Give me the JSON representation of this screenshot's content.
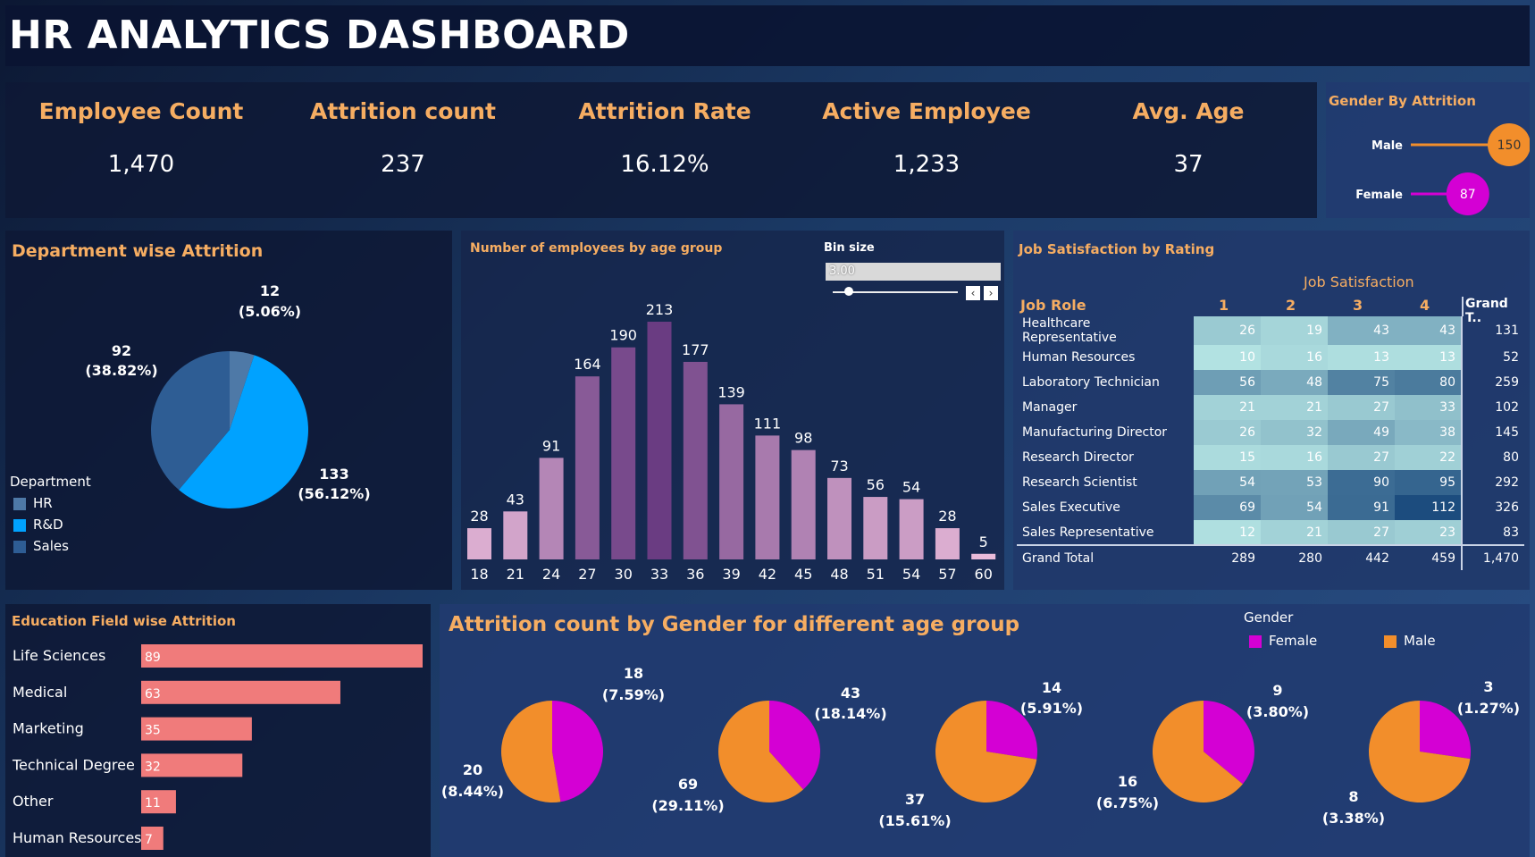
{
  "header": {
    "title": "HR ANALYTICS DASHBOARD"
  },
  "kpis": [
    {
      "label": "Employee Count",
      "value": "1,470"
    },
    {
      "label": "Attrition count",
      "value": "237"
    },
    {
      "label": "Attrition Rate",
      "value": "16.12%"
    },
    {
      "label": "Active Employee",
      "value": "1,233"
    },
    {
      "label": "Avg. Age",
      "value": "37"
    }
  ],
  "colors": {
    "accent": "#f6ad62",
    "hr": "#4e79a7",
    "rnd": "#00a2ff",
    "sales": "#2e5d94",
    "female": "#d400d4",
    "male": "#f28e2b",
    "edu_bar": "#f07b7b"
  },
  "gender_attrition": {
    "title": "Gender By Attrition",
    "rows": [
      {
        "label": "Male",
        "value": 150
      },
      {
        "label": "Female",
        "value": 87
      }
    ]
  },
  "department": {
    "title": "Department wise Attrition",
    "legend_title": "Department",
    "legend": [
      "HR",
      "R&D",
      "Sales"
    ],
    "slices": [
      {
        "name": "HR",
        "value": 12,
        "label": "12",
        "pct": "(5.06%)"
      },
      {
        "name": "R&D",
        "value": 133,
        "label": "133",
        "pct": "(56.12%)"
      },
      {
        "name": "Sales",
        "value": 92,
        "label": "92",
        "pct": "(38.82%)"
      }
    ]
  },
  "age_hist": {
    "title": "Number of employees by age group",
    "bin_label": "Bin size",
    "bin_value": "3.00"
  },
  "job_satisfaction": {
    "title": "Job Satisfaction by Rating",
    "group_header": "Job Satisfaction",
    "col_role": "Job Role",
    "cols": [
      "1",
      "2",
      "3",
      "4"
    ],
    "col_total": "Grand T..",
    "rows": [
      {
        "role": "Healthcare Representative",
        "v": [
          26,
          19,
          43,
          43
        ],
        "total": "131"
      },
      {
        "role": "Human Resources",
        "v": [
          10,
          16,
          13,
          13
        ],
        "total": "52"
      },
      {
        "role": "Laboratory Technician",
        "v": [
          56,
          48,
          75,
          80
        ],
        "total": "259"
      },
      {
        "role": "Manager",
        "v": [
          21,
          21,
          27,
          33
        ],
        "total": "102"
      },
      {
        "role": "Manufacturing Director",
        "v": [
          26,
          32,
          49,
          38
        ],
        "total": "145"
      },
      {
        "role": "Research Director",
        "v": [
          15,
          16,
          27,
          22
        ],
        "total": "80"
      },
      {
        "role": "Research Scientist",
        "v": [
          54,
          53,
          90,
          95
        ],
        "total": "292"
      },
      {
        "role": "Sales Executive",
        "v": [
          69,
          54,
          91,
          112
        ],
        "total": "326"
      },
      {
        "role": "Sales Representative",
        "v": [
          12,
          21,
          27,
          23
        ],
        "total": "83"
      }
    ],
    "grand_total": {
      "role": "Grand Total",
      "v": [
        "289",
        "280",
        "442",
        "459"
      ],
      "total": "1,470"
    }
  },
  "education": {
    "title": "Education Field wise Attrition",
    "items": [
      {
        "label": "Life Sciences",
        "value": 89
      },
      {
        "label": "Medical",
        "value": 63
      },
      {
        "label": "Marketing",
        "value": 35
      },
      {
        "label": "Technical Degree",
        "value": 32
      },
      {
        "label": "Other",
        "value": 11
      },
      {
        "label": "Human Resources",
        "value": 7
      }
    ]
  },
  "gender_age": {
    "title": "Attrition count by Gender for different age group",
    "legend_title": "Gender",
    "legend": [
      "Female",
      "Male"
    ]
  },
  "chart_data": [
    {
      "type": "bar",
      "title": "Number of employees by age group",
      "categories": [
        "18",
        "21",
        "24",
        "27",
        "30",
        "33",
        "36",
        "39",
        "42",
        "45",
        "48",
        "51",
        "54",
        "57",
        "60"
      ],
      "values": [
        28,
        43,
        91,
        164,
        190,
        213,
        177,
        139,
        111,
        98,
        73,
        56,
        54,
        28,
        5
      ]
    },
    {
      "type": "pie",
      "title": "Department wise Attrition",
      "categories": [
        "HR",
        "R&D",
        "Sales"
      ],
      "values": [
        12,
        133,
        92
      ]
    },
    {
      "type": "bar",
      "title": "Education Field wise Attrition",
      "categories": [
        "Life Sciences",
        "Medical",
        "Marketing",
        "Technical Degree",
        "Other",
        "Human Resources"
      ],
      "values": [
        89,
        63,
        35,
        32,
        11,
        7
      ]
    },
    {
      "type": "bar",
      "title": "Gender By Attrition",
      "categories": [
        "Male",
        "Female"
      ],
      "values": [
        150,
        87
      ]
    },
    {
      "type": "pie",
      "title": "Attrition count by Gender for different age group",
      "series": [
        {
          "female": 18,
          "female_pct": "(7.59%)",
          "male": 20,
          "male_pct": "(8.44%)"
        },
        {
          "female": 43,
          "female_pct": "(18.14%)",
          "male": 69,
          "male_pct": "(29.11%)"
        },
        {
          "female": 14,
          "female_pct": "(5.91%)",
          "male": 37,
          "male_pct": "(15.61%)"
        },
        {
          "female": 9,
          "female_pct": "(3.80%)",
          "male": 16,
          "male_pct": "(6.75%)"
        },
        {
          "female": 3,
          "female_pct": "(1.27%)",
          "male": 8,
          "male_pct": "(3.38%)"
        }
      ]
    }
  ]
}
